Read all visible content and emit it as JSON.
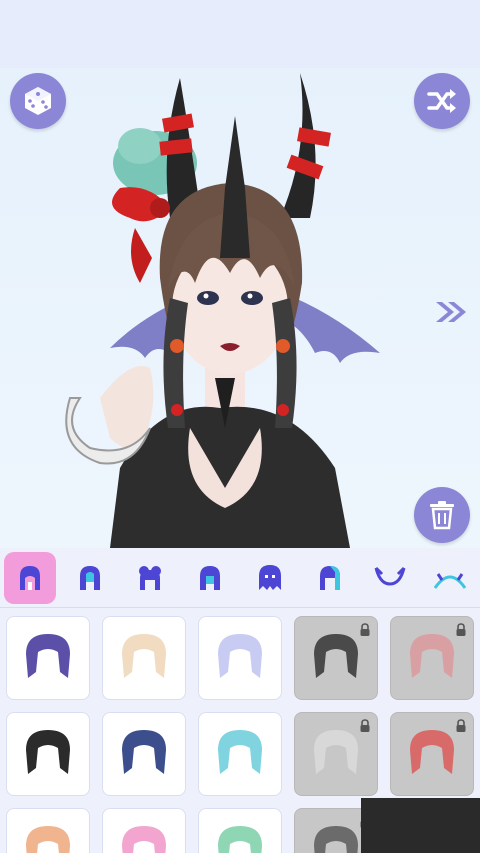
{
  "header": {},
  "stage": {
    "buttons": [
      "dice-random",
      "shuffle",
      "next-arrow",
      "trash"
    ]
  },
  "tabs": [
    {
      "id": "hair-full",
      "icon": "hair-full-icon",
      "active": true
    },
    {
      "id": "hair-front",
      "icon": "hair-front-icon",
      "active": false
    },
    {
      "id": "hair-bun",
      "icon": "hair-bun-icon",
      "active": false
    },
    {
      "id": "hair-side",
      "icon": "hair-side-icon",
      "active": false
    },
    {
      "id": "hair-back",
      "icon": "hair-back-icon",
      "active": false
    },
    {
      "id": "hair-long",
      "icon": "hair-long-icon",
      "active": false
    },
    {
      "id": "horns",
      "icon": "horns-icon",
      "active": false
    },
    {
      "id": "headband",
      "icon": "headband-icon",
      "active": false
    }
  ],
  "hair_items": [
    {
      "color": "#5b4fa8",
      "locked": false
    },
    {
      "color": "#f1dcc2",
      "locked": false
    },
    {
      "color": "#c9ccf2",
      "locked": false
    },
    {
      "color": "#4a4a4a",
      "locked": true
    },
    {
      "color": "#d9a0a3",
      "locked": true
    },
    {
      "color": "#2b2b2b",
      "locked": false
    },
    {
      "color": "#3c4f8c",
      "locked": false
    },
    {
      "color": "#7fd4e0",
      "locked": false
    },
    {
      "color": "#d8d8d8",
      "locked": true
    },
    {
      "color": "#d96a6a",
      "locked": true
    },
    {
      "color": "#f0b48e",
      "locked": false
    },
    {
      "color": "#f2a6cf",
      "locked": false
    },
    {
      "color": "#8fd7b4",
      "locked": false
    },
    {
      "color": "#6b6b6b",
      "locked": true
    }
  ],
  "colors": {
    "accent": "#8c86d6",
    "active_tab": "#f29cdb",
    "tab_icon": "#5a4fd8",
    "tab_icon_alt": "#3ec6e0"
  }
}
